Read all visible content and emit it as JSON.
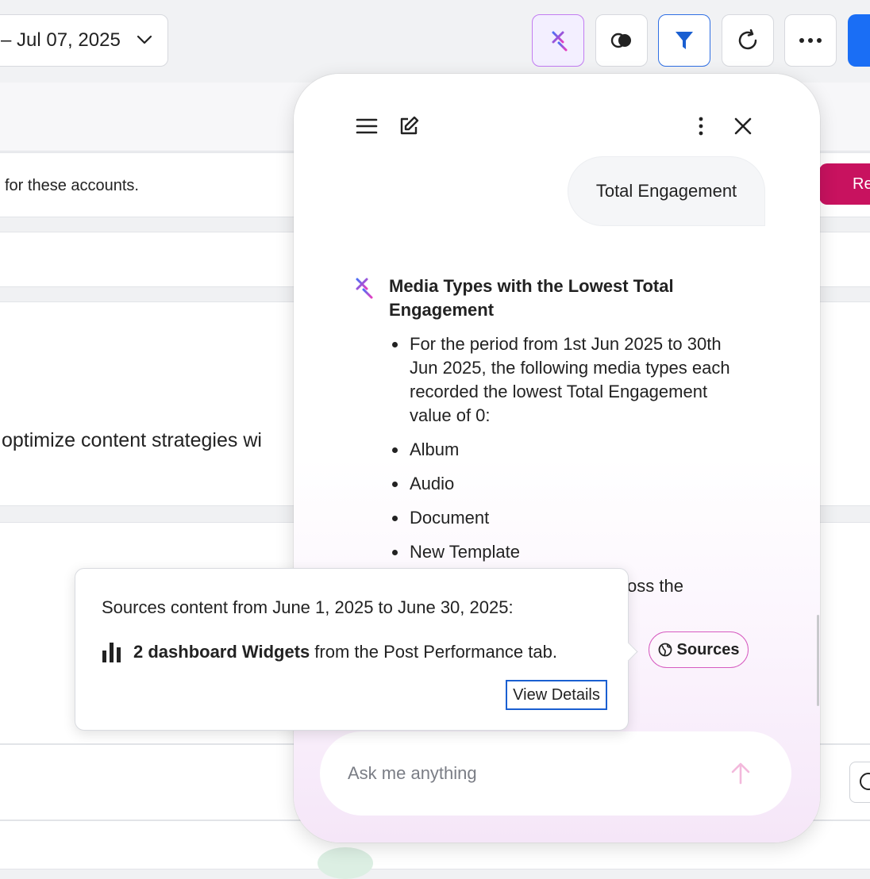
{
  "toolbar": {
    "date_range": "– Jul 07, 2025",
    "icons": [
      "ai-sparkle-icon",
      "toggle-icon",
      "filter-icon",
      "refresh-icon",
      "more-horizontal-icon"
    ],
    "colors": {
      "primary": "#1a6ef5",
      "accent_purple": "#c27cf2",
      "filter_blue": "#2f6fe4"
    }
  },
  "background": {
    "row1_text": "for these accounts.",
    "row2_text": "optimize content strategies wi",
    "red_button_label": "Re",
    "red_button_color": "#c8125f"
  },
  "chat": {
    "user_message": "Total Engagement",
    "response": {
      "title": "Media Types with the Lowest Total Engagement",
      "items": [
        "For the period from 1st Jun 2025 to 30th Jun 2025, the following media types each recorded the lowest Total Engagement value of 0:",
        "Album",
        "Audio",
        "Document",
        "New Template"
      ],
      "partial_text": "oss the"
    },
    "sources_label": "Sources",
    "input_placeholder": "Ask me anything"
  },
  "popover": {
    "line1": "Sources content from June 1, 2025 to June 30, 2025:",
    "widgets_count": "2 dashboard Widgets",
    "widgets_suffix": "from the Post Performance tab.",
    "view_details": "View Details"
  }
}
